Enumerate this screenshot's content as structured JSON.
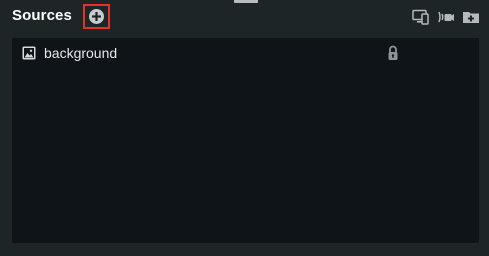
{
  "sources": {
    "title": "Sources",
    "add_icon": "plus-circle-icon",
    "header_icons": [
      "copy-screen-icon",
      "filter-icon",
      "add-folder-icon"
    ],
    "items": [
      {
        "label": "background",
        "icon": "image-icon",
        "locked": true,
        "lock_icon": "lock-icon"
      }
    ]
  }
}
